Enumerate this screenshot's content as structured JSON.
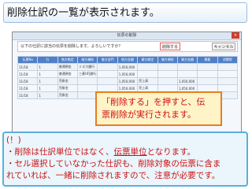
{
  "heading": "削除仕訳の一覧が表示されます。",
  "window": {
    "title": "伝票の削除",
    "close": "×",
    "confirm_message": "以下の仕訳に該当の伝票を削除します。よろしいですか？",
    "delete_button": "削除する",
    "cancel_button": "キャンセル"
  },
  "grid": {
    "headers": [
      "伝票No",
      "行",
      "借方勘定",
      "借方補助",
      "借方部門",
      "借方金額",
      "貸方勘定",
      "貸方補助",
      "貸方金額",
      "摘要",
      "消費税"
    ],
    "rows": [
      [
        "11/18",
        "1",
        "普通預金",
        "ミズホ銀行",
        "",
        "1,050,000",
        "",
        "",
        "",
        "",
        ""
      ],
      [
        "11/18",
        "1",
        "普通預金",
        "三菱UFJ銀行",
        "",
        "1,050,000",
        "",
        "",
        "",
        "",
        ""
      ],
      [
        "11/18",
        "1",
        "売掛金",
        "",
        "",
        "1,050,000",
        "売上高",
        "",
        "1,050,000",
        "",
        ""
      ],
      [
        "11/18",
        "1",
        "売掛金",
        "",
        "",
        "1,050,000",
        "売上高",
        "",
        "1,050,000",
        "",
        ""
      ],
      [
        "11/18",
        "1",
        "売掛金",
        "",
        "",
        "",
        "売上高",
        "",
        "",
        "",
        ""
      ]
    ]
  },
  "callout": {
    "line1": "「削除する」を押すと、伝",
    "line2": "票削除が実行されます。"
  },
  "note": {
    "line1": "(！)",
    "line2a": "・削除は仕訳単位ではなく、",
    "line2b": "伝票単位",
    "line2c": "となります。",
    "line3": "・セル選択していなかった仕訳も、削除対象の伝票に含ま",
    "line4": "れていれば、一緒に削除されますので、注意が必要です。"
  },
  "colors": {
    "accent_red": "#cc1111",
    "callout_border": "#e67e22",
    "note_border": "#5aaedc"
  }
}
